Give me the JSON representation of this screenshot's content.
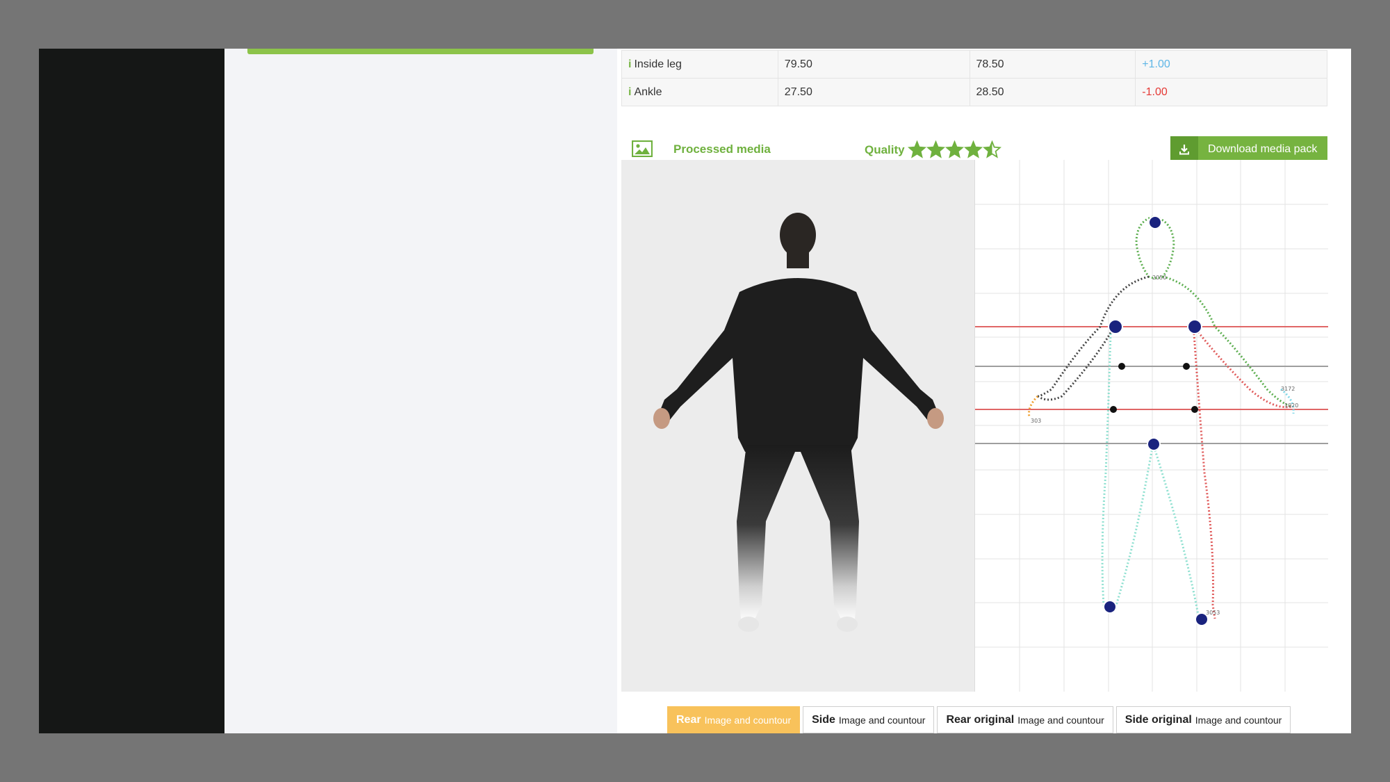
{
  "measurements": {
    "rows": [
      {
        "label": "Inside leg",
        "v1": "79.50",
        "v2": "78.50",
        "diff": "+1.00"
      },
      {
        "label": "Ankle",
        "v1": "27.50",
        "v2": "28.50",
        "diff": "-1.00"
      }
    ]
  },
  "media": {
    "title": "Processed media",
    "quality_label": "Quality",
    "quality_rating": 4.5,
    "quality_max": 5,
    "download_label": "Download media pack"
  },
  "contour": {
    "labels": [
      "2050",
      "303",
      "3172",
      "1020",
      "3053"
    ]
  },
  "tabs": [
    {
      "title": "Rear",
      "subtitle": "Image and countour",
      "active": true
    },
    {
      "title": "Side",
      "subtitle": "Image and countour",
      "active": false
    },
    {
      "title": "Rear original",
      "subtitle": "Image and countour",
      "active": false
    },
    {
      "title": "Side original",
      "subtitle": "Image and countour",
      "active": false
    }
  ],
  "colors": {
    "accent_green": "#76b340",
    "active_tab": "#f8c25b",
    "positive": "#5fb6e6",
    "negative": "#e53935"
  },
  "icons": {
    "media": "image-icon",
    "download": "download-icon",
    "quality": "star-icon"
  }
}
